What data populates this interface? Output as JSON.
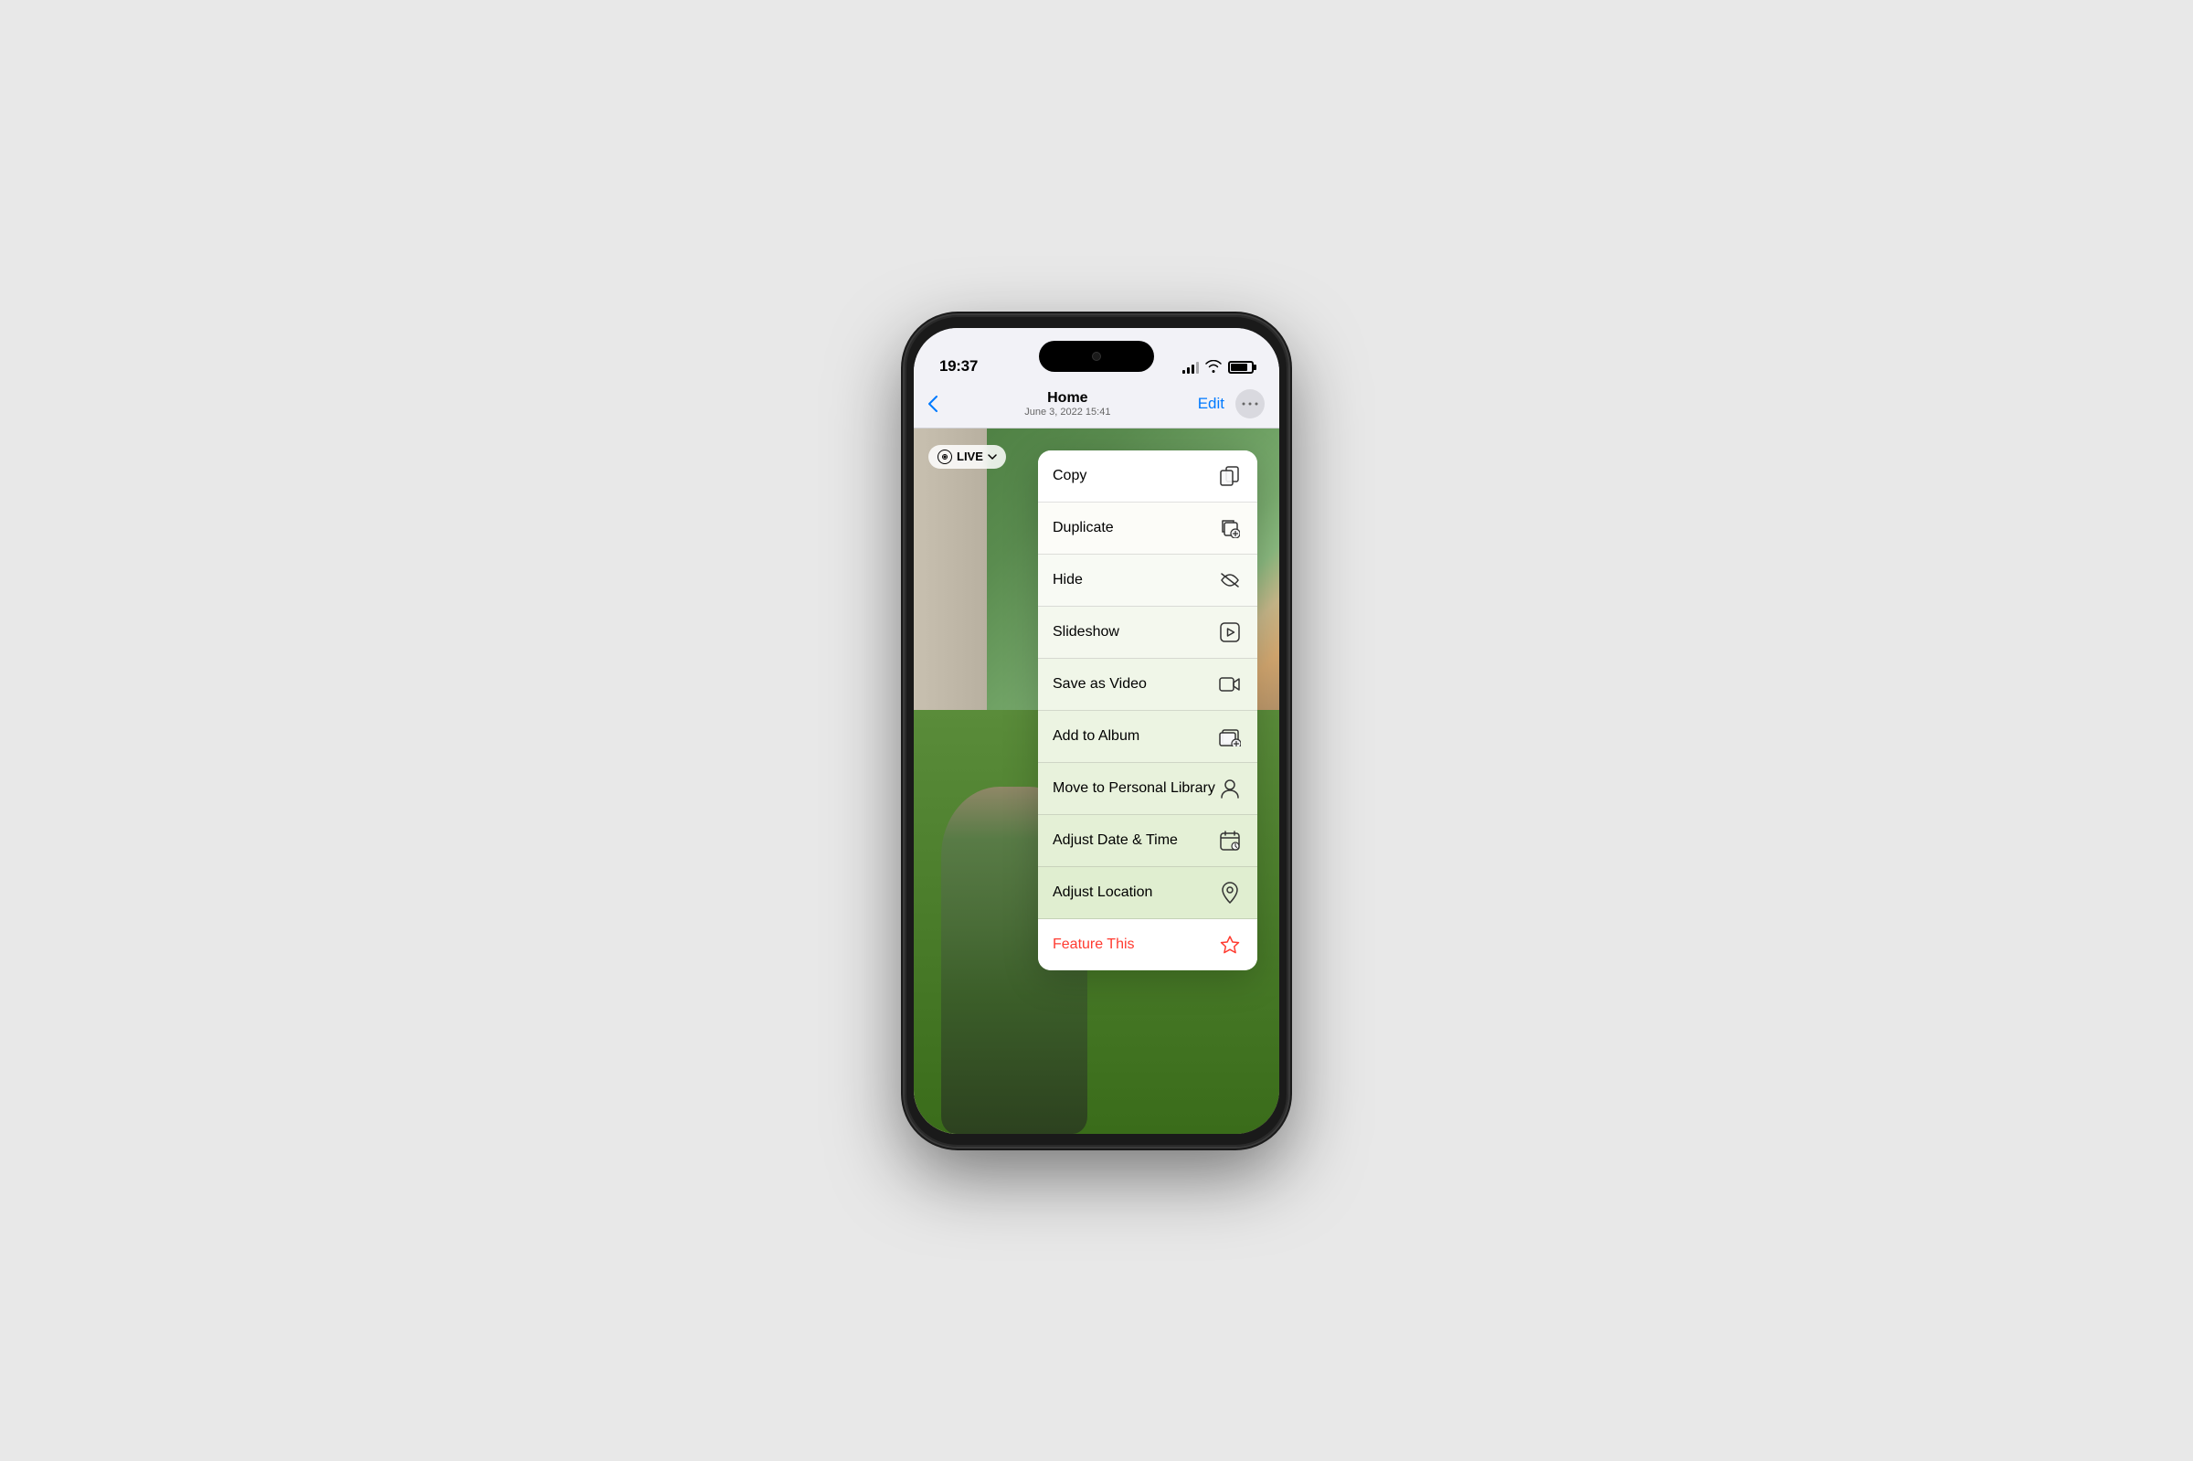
{
  "status_bar": {
    "time": "19:37"
  },
  "nav": {
    "back_label": "‹",
    "title": "Home",
    "subtitle": "June 3, 2022  15:41",
    "edit_label": "Edit",
    "more_dots": "•••"
  },
  "live_badge": {
    "label": "LIVE",
    "chevron": "∨"
  },
  "context_menu": {
    "items": [
      {
        "label": "Copy",
        "icon": "copy"
      },
      {
        "label": "Duplicate",
        "icon": "duplicate"
      },
      {
        "label": "Hide",
        "icon": "hide"
      },
      {
        "label": "Slideshow",
        "icon": "play"
      },
      {
        "label": "Save as Video",
        "icon": "video"
      },
      {
        "label": "Add to Album",
        "icon": "add-album"
      },
      {
        "label": "Move to Personal Library",
        "icon": "person"
      },
      {
        "label": "Adjust Date & Time",
        "icon": "calendar"
      },
      {
        "label": "Adjust Location",
        "icon": "location"
      },
      {
        "label": "Feature This",
        "icon": "feature",
        "red": true
      }
    ]
  }
}
